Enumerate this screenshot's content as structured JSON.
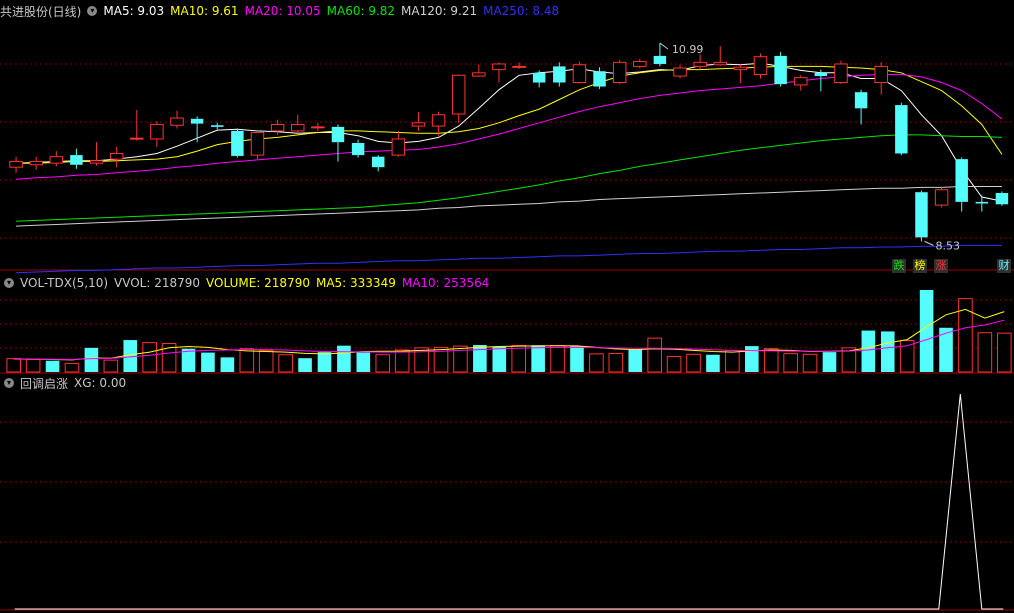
{
  "price_header": {
    "title": "共进股份(日线)",
    "ma5": "MA5: 9.03",
    "ma10": "MA10: 9.61",
    "ma20": "MA20: 10.05",
    "ma60": "MA60: 9.82",
    "ma120": "MA120: 9.21",
    "ma250": "MA250: 8.48"
  },
  "volume_header": {
    "title": "VOL-TDX(5,10)",
    "vvol": "VVOL: 218790",
    "volume": "VOLUME: 218790",
    "ma5": "MA5: 333349",
    "ma10": "MA10: 253564"
  },
  "indicator_header": {
    "title": "回调启涨",
    "xg": "XG: 0.00"
  },
  "annotations": {
    "high": "10.99",
    "low": "8.53"
  },
  "badges": {
    "b1": "跌",
    "b2": "榜",
    "b3": "涨",
    "b4": "财"
  },
  "colors": {
    "up": "#ff3232",
    "down": "#54fcfc",
    "ma5": "#ffffff",
    "ma10": "#ffff00",
    "ma20": "#ff00ff",
    "ma60": "#00e600",
    "ma120": "#d0d0d0",
    "ma250": "#3030ff",
    "grid": "#8b0000"
  },
  "chart_data": [
    {
      "type": "candlestick",
      "title": "共进股份(日线)",
      "ylim": [
        8.2,
        11.3
      ],
      "candles": [
        {
          "o": 9.45,
          "c": 9.52,
          "h": 9.58,
          "l": 9.38
        },
        {
          "o": 9.48,
          "c": 9.52,
          "h": 9.58,
          "l": 9.42
        },
        {
          "o": 9.5,
          "c": 9.58,
          "h": 9.65,
          "l": 9.46
        },
        {
          "o": 9.6,
          "c": 9.48,
          "h": 9.68,
          "l": 9.43
        },
        {
          "o": 9.5,
          "c": 9.53,
          "h": 9.76,
          "l": 9.47
        },
        {
          "o": 9.55,
          "c": 9.62,
          "h": 9.7,
          "l": 9.45
        },
        {
          "o": 9.8,
          "c": 9.81,
          "h": 10.16,
          "l": 9.78
        },
        {
          "o": 9.8,
          "c": 9.98,
          "h": 10.02,
          "l": 9.7
        },
        {
          "o": 9.97,
          "c": 10.06,
          "h": 10.15,
          "l": 9.93
        },
        {
          "o": 10.05,
          "c": 9.99,
          "h": 10.08,
          "l": 9.76
        },
        {
          "o": 9.97,
          "c": 9.95,
          "h": 10.0,
          "l": 9.92
        },
        {
          "o": 9.9,
          "c": 9.59,
          "h": 9.93,
          "l": 9.57
        },
        {
          "o": 9.6,
          "c": 9.88,
          "h": 9.9,
          "l": 9.55
        },
        {
          "o": 9.9,
          "c": 9.98,
          "h": 10.04,
          "l": 9.85
        },
        {
          "o": 9.9,
          "c": 9.98,
          "h": 10.1,
          "l": 9.87
        },
        {
          "o": 9.95,
          "c": 9.95,
          "h": 10.0,
          "l": 9.9
        },
        {
          "o": 9.95,
          "c": 9.76,
          "h": 9.98,
          "l": 9.52
        },
        {
          "o": 9.75,
          "c": 9.6,
          "h": 9.79,
          "l": 9.57
        },
        {
          "o": 9.58,
          "c": 9.45,
          "h": 9.6,
          "l": 9.4
        },
        {
          "o": 9.6,
          "c": 9.8,
          "h": 9.9,
          "l": 9.58
        },
        {
          "o": 9.96,
          "c": 10.0,
          "h": 10.13,
          "l": 9.9
        },
        {
          "o": 9.96,
          "c": 10.1,
          "h": 10.14,
          "l": 9.84
        },
        {
          "o": 10.11,
          "c": 10.59,
          "h": 10.6,
          "l": 10.0
        },
        {
          "o": 10.58,
          "c": 10.62,
          "h": 10.72,
          "l": 10.57
        },
        {
          "o": 10.66,
          "c": 10.73,
          "h": 10.75,
          "l": 10.5
        },
        {
          "o": 10.7,
          "c": 10.7,
          "h": 10.75,
          "l": 10.67
        },
        {
          "o": 10.62,
          "c": 10.5,
          "h": 10.65,
          "l": 10.44
        },
        {
          "o": 10.7,
          "c": 10.5,
          "h": 10.75,
          "l": 10.45
        },
        {
          "o": 10.5,
          "c": 10.72,
          "h": 10.76,
          "l": 10.49
        },
        {
          "o": 10.64,
          "c": 10.45,
          "h": 10.69,
          "l": 10.42
        },
        {
          "o": 10.5,
          "c": 10.75,
          "h": 10.78,
          "l": 10.48
        },
        {
          "o": 10.7,
          "c": 10.76,
          "h": 10.79,
          "l": 10.68
        },
        {
          "o": 10.83,
          "c": 10.73,
          "h": 10.99,
          "l": 10.7
        },
        {
          "o": 10.58,
          "c": 10.68,
          "h": 10.72,
          "l": 10.55
        },
        {
          "o": 10.7,
          "c": 10.75,
          "h": 10.85,
          "l": 10.66
        },
        {
          "o": 10.72,
          "c": 10.75,
          "h": 10.95,
          "l": 10.71
        },
        {
          "o": 10.66,
          "c": 10.69,
          "h": 10.72,
          "l": 10.49
        },
        {
          "o": 10.6,
          "c": 10.82,
          "h": 10.86,
          "l": 10.55
        },
        {
          "o": 10.83,
          "c": 10.48,
          "h": 10.88,
          "l": 10.45
        },
        {
          "o": 10.47,
          "c": 10.56,
          "h": 10.59,
          "l": 10.4
        },
        {
          "o": 10.62,
          "c": 10.58,
          "h": 10.66,
          "l": 10.39
        },
        {
          "o": 10.5,
          "c": 10.73,
          "h": 10.77,
          "l": 10.48
        },
        {
          "o": 10.38,
          "c": 10.18,
          "h": 10.41,
          "l": 9.98
        },
        {
          "o": 10.5,
          "c": 10.7,
          "h": 10.75,
          "l": 10.35
        },
        {
          "o": 10.22,
          "c": 9.62,
          "h": 10.25,
          "l": 9.6
        },
        {
          "o": 9.14,
          "c": 8.58,
          "h": 9.16,
          "l": 8.53
        },
        {
          "o": 8.98,
          "c": 9.17,
          "h": 9.2,
          "l": 8.95
        },
        {
          "o": 9.55,
          "c": 9.02,
          "h": 9.57,
          "l": 8.9
        },
        {
          "o": 9.02,
          "c": 9.0,
          "h": 9.1,
          "l": 8.9
        },
        {
          "o": 9.13,
          "c": 8.99,
          "h": 9.15,
          "l": 8.97
        }
      ],
      "ma_lines": [
        {
          "name": "MA5",
          "values": [
            9.5,
            9.51,
            9.52,
            9.53,
            9.53,
            9.55,
            9.58,
            9.62,
            9.71,
            9.81,
            9.91,
            9.92,
            9.9,
            9.89,
            9.87,
            9.88,
            9.88,
            9.84,
            9.77,
            9.75,
            9.77,
            9.82,
            9.96,
            10.18,
            10.41,
            10.59,
            10.62,
            10.64,
            10.67,
            10.63,
            10.61,
            10.63,
            10.66,
            10.65,
            10.71,
            10.73,
            10.72,
            10.74,
            10.7,
            10.65,
            10.62,
            10.62,
            10.55,
            10.55,
            10.4,
            10.1,
            9.84,
            9.42,
            9.08,
            9.03
          ]
        },
        {
          "name": "MA10",
          "values": [
            9.5,
            9.5,
            9.51,
            9.52,
            9.52,
            9.53,
            9.54,
            9.55,
            9.58,
            9.65,
            9.73,
            9.77,
            9.8,
            9.82,
            9.85,
            9.88,
            9.9,
            9.9,
            9.89,
            9.88,
            9.87,
            9.87,
            9.89,
            9.93,
            10.0,
            10.09,
            10.17,
            10.29,
            10.41,
            10.5,
            10.58,
            10.62,
            10.65,
            10.66,
            10.66,
            10.67,
            10.68,
            10.69,
            10.7,
            10.7,
            10.7,
            10.69,
            10.68,
            10.66,
            10.62,
            10.51,
            10.4,
            10.21,
            9.98,
            9.61
          ]
        },
        {
          "name": "MA20",
          "values": [
            9.3,
            9.32,
            9.33,
            9.35,
            9.36,
            9.38,
            9.4,
            9.42,
            9.45,
            9.47,
            9.5,
            9.52,
            9.54,
            9.56,
            9.58,
            9.6,
            9.62,
            9.64,
            9.65,
            9.66,
            9.67,
            9.7,
            9.74,
            9.8,
            9.86,
            9.93,
            10.0,
            10.07,
            10.14,
            10.2,
            10.25,
            10.3,
            10.34,
            10.37,
            10.4,
            10.42,
            10.44,
            10.46,
            10.49,
            10.52,
            10.55,
            10.57,
            10.59,
            10.6,
            10.6,
            10.57,
            10.5,
            10.4,
            10.24,
            10.05
          ]
        },
        {
          "name": "MA60",
          "values": [
            8.78,
            8.79,
            8.8,
            8.81,
            8.82,
            8.83,
            8.84,
            8.85,
            8.86,
            8.87,
            8.88,
            8.89,
            8.9,
            8.91,
            8.92,
            8.93,
            8.94,
            8.95,
            8.97,
            8.99,
            9.01,
            9.04,
            9.07,
            9.11,
            9.15,
            9.19,
            9.23,
            9.28,
            9.32,
            9.37,
            9.41,
            9.46,
            9.5,
            9.54,
            9.58,
            9.62,
            9.66,
            9.69,
            9.72,
            9.75,
            9.78,
            9.8,
            9.82,
            9.84,
            9.85,
            9.85,
            9.84,
            9.83,
            9.83,
            9.82
          ]
        },
        {
          "name": "MA120",
          "values": [
            8.72,
            8.73,
            8.74,
            8.75,
            8.76,
            8.77,
            8.78,
            8.79,
            8.8,
            8.81,
            8.82,
            8.83,
            8.84,
            8.85,
            8.86,
            8.87,
            8.88,
            8.89,
            8.9,
            8.91,
            8.92,
            8.94,
            8.95,
            8.97,
            8.98,
            8.99,
            9.0,
            9.02,
            9.03,
            9.05,
            9.06,
            9.07,
            9.08,
            9.09,
            9.1,
            9.11,
            9.12,
            9.13,
            9.14,
            9.15,
            9.16,
            9.17,
            9.18,
            9.19,
            9.19,
            9.2,
            9.2,
            9.21,
            9.21,
            9.21
          ]
        },
        {
          "name": "MA250",
          "values": [
            8.14,
            8.15,
            8.16,
            8.17,
            8.17,
            8.18,
            8.19,
            8.2,
            8.2,
            8.21,
            8.22,
            8.23,
            8.23,
            8.24,
            8.25,
            8.26,
            8.26,
            8.27,
            8.28,
            8.29,
            8.29,
            8.3,
            8.31,
            8.32,
            8.32,
            8.33,
            8.34,
            8.35,
            8.35,
            8.36,
            8.37,
            8.38,
            8.38,
            8.39,
            8.4,
            8.41,
            8.41,
            8.42,
            8.43,
            8.43,
            8.44,
            8.45,
            8.45,
            8.46,
            8.46,
            8.47,
            8.47,
            8.48,
            8.48,
            8.48
          ]
        }
      ]
    },
    {
      "type": "bar",
      "title": "VOL-TDX(5,10)",
      "ylim": [
        0,
        380000
      ],
      "values": [
        62000,
        58000,
        52000,
        40000,
        112000,
        55000,
        148000,
        136000,
        132000,
        108000,
        90000,
        68000,
        108000,
        100000,
        80000,
        64000,
        92000,
        122000,
        90000,
        80000,
        102000,
        112000,
        114000,
        120000,
        125000,
        118000,
        123000,
        124000,
        122000,
        120000,
        84000,
        86000,
        104000,
        157000,
        72000,
        82000,
        80000,
        100000,
        120000,
        108000,
        85000,
        82000,
        92000,
        112000,
        192000,
        188000,
        146000,
        402000,
        205000,
        340000,
        182000,
        180000
      ],
      "direction": [
        "up",
        "up",
        "down",
        "up",
        "down",
        "up",
        "down",
        "up",
        "up",
        "down",
        "down",
        "down",
        "up",
        "up",
        "up",
        "down",
        "down",
        "down",
        "down",
        "up",
        "up",
        "up",
        "up",
        "up",
        "down",
        "down",
        "up",
        "down",
        "up",
        "down",
        "up",
        "up",
        "down",
        "up",
        "up",
        "up",
        "down",
        "up",
        "down",
        "up",
        "up",
        "up",
        "down",
        "up",
        "down",
        "down",
        "up",
        "down",
        "down",
        "up",
        "up",
        "up"
      ],
      "ma_lines": [
        {
          "name": "MA5",
          "values": [
            60000,
            60000,
            58000,
            56000,
            65000,
            64000,
            80000,
            92000,
            112000,
            118000,
            114000,
            104000,
            98000,
            95000,
            92000,
            86000,
            84000,
            88000,
            95000,
            96000,
            97000,
            100000,
            104000,
            109000,
            115000,
            118000,
            120000,
            121000,
            122000,
            121000,
            114000,
            107000,
            104000,
            108000,
            106000,
            100000,
            95000,
            92000,
            98000,
            102000,
            100000,
            95000,
            96000,
            98000,
            112000,
            135000,
            150000,
            210000,
            265000,
            290000,
            250000,
            280000
          ]
        },
        {
          "name": "MA10",
          "values": [
            60000,
            60000,
            59000,
            58000,
            62000,
            63000,
            70000,
            78000,
            88000,
            96000,
            100000,
            102000,
            104000,
            104000,
            102000,
            98000,
            95000,
            94000,
            93000,
            92000,
            92000,
            94000,
            96000,
            100000,
            104000,
            108000,
            110000,
            112000,
            114000,
            115000,
            113000,
            111000,
            110000,
            110000,
            109000,
            106000,
            103000,
            100000,
            99000,
            98000,
            97000,
            96000,
            96000,
            97000,
            102000,
            112000,
            122000,
            150000,
            180000,
            205000,
            218000,
            240000
          ]
        }
      ]
    },
    {
      "type": "line",
      "title": "回调启涨",
      "ylim": [
        0,
        1
      ],
      "series": [
        {
          "name": "XG",
          "values": [
            0,
            0,
            0,
            0,
            0,
            0,
            0,
            0,
            0,
            0,
            0,
            0,
            0,
            0,
            0,
            0,
            0,
            0,
            0,
            0,
            0,
            0,
            0,
            0,
            0,
            0,
            0,
            0,
            0,
            0,
            0,
            0,
            0,
            0,
            0,
            0,
            0,
            0,
            0,
            0,
            0,
            0,
            0,
            0,
            1,
            0,
            0
          ]
        }
      ]
    }
  ]
}
